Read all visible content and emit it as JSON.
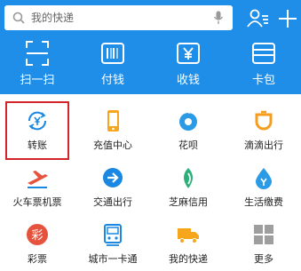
{
  "search": {
    "placeholder": "我的快递"
  },
  "quick_actions": [
    {
      "label": "扫一扫",
      "icon": "scan-icon"
    },
    {
      "label": "付钱",
      "icon": "barcode-icon"
    },
    {
      "label": "收钱",
      "icon": "yen-icon"
    },
    {
      "label": "卡包",
      "icon": "card-icon"
    }
  ],
  "grid": [
    {
      "label": "转账",
      "icon": "transfer-icon",
      "color": "#1a88e3"
    },
    {
      "label": "充值中心",
      "icon": "phone-icon",
      "color": "#f7a61b"
    },
    {
      "label": "花呗",
      "icon": "huabei-icon",
      "color": "#2b9be5"
    },
    {
      "label": "滴滴出行",
      "icon": "didi-icon",
      "color": "#f59d1c"
    },
    {
      "label": "火车票机票",
      "icon": "train-icon",
      "color": "#e6533d"
    },
    {
      "label": "交通出行",
      "icon": "arrow-icon",
      "color": "#1a88e3"
    },
    {
      "label": "芝麻信用",
      "icon": "sesame-icon",
      "color": "#2bb07a"
    },
    {
      "label": "生活缴费",
      "icon": "drop-icon",
      "color": "#2b9be5"
    },
    {
      "label": "彩票",
      "icon": "lottery-icon",
      "color": "#e6533d",
      "glyph": "彩"
    },
    {
      "label": "城市一卡通",
      "icon": "citycard-icon",
      "color": "#1a88e3"
    },
    {
      "label": "我的快递",
      "icon": "truck-icon",
      "color": "#f7a61b"
    },
    {
      "label": "更多",
      "icon": "grid-icon",
      "color": "#9e9e9e"
    }
  ]
}
